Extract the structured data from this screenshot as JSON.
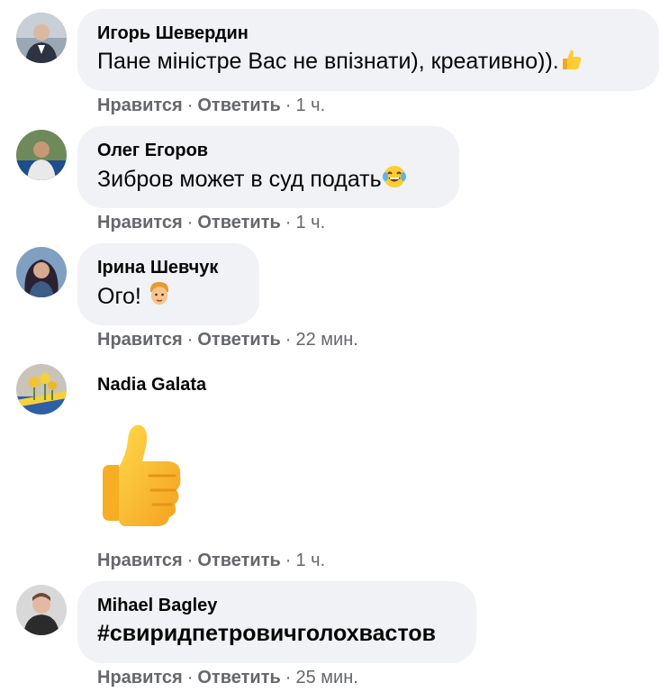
{
  "comments": [
    {
      "author": "Игорь Шевердин",
      "text": "Пане міністре Вас не впізнати), креативно)).",
      "emoji": "thumbs-up",
      "like": "Нравится",
      "reply": "Ответить",
      "time": "1 ч."
    },
    {
      "author": "Олег Егоров",
      "text": "Зибров может в суд подать",
      "emoji": "tears-of-joy",
      "like": "Нравится",
      "reply": "Ответить",
      "time": "1 ч."
    },
    {
      "author": "Ірина Шевчук",
      "text": "Ого! ",
      "emoji": "man-face",
      "like": "Нравится",
      "reply": "Ответить",
      "time": "22 мин."
    },
    {
      "author": "Nadia Galata",
      "sticker": "thumbs-up-sticker",
      "like": "Нравится",
      "reply": "Ответить",
      "time": "1 ч."
    },
    {
      "author": "Mihael Bagley",
      "text": "#свиридпетровичголохвастов",
      "like": "Нравится",
      "reply": "Ответить",
      "time": "25 мин."
    }
  ],
  "colors": {
    "bubble": "#f0f2f5",
    "meta": "#65676b",
    "text": "#050505"
  }
}
